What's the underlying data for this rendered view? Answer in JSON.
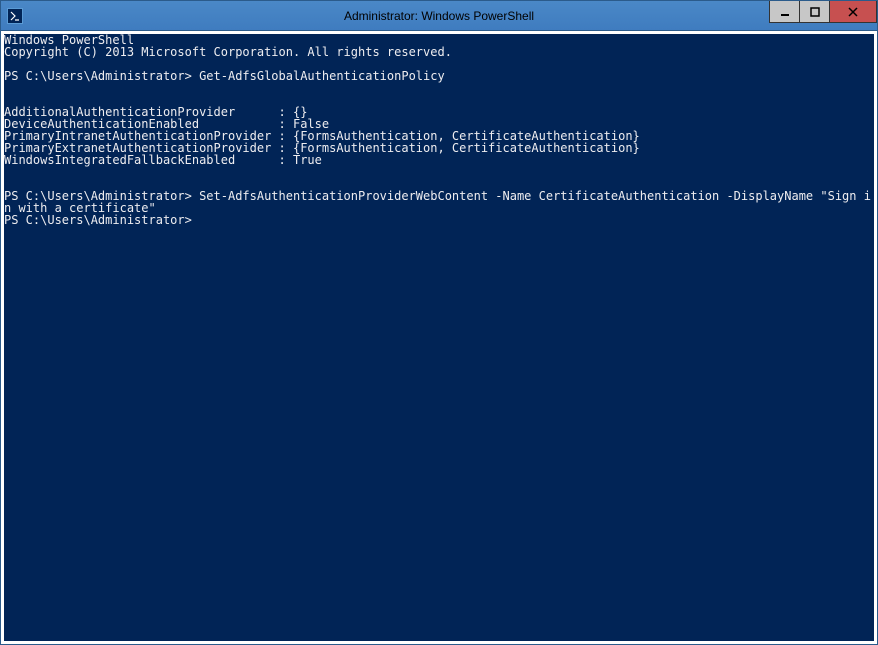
{
  "window": {
    "title": "Administrator: Windows PowerShell"
  },
  "console": {
    "banner": [
      "Windows PowerShell",
      "Copyright (C) 2013 Microsoft Corporation. All rights reserved."
    ],
    "prompt1": "PS C:\\Users\\Administrator>",
    "cmd1": "Get-AdfsGlobalAuthenticationPolicy",
    "output1": [
      "",
      "",
      "AdditionalAuthenticationProvider      : {}",
      "DeviceAuthenticationEnabled           : False",
      "PrimaryIntranetAuthenticationProvider : {FormsAuthentication, CertificateAuthentication}",
      "PrimaryExtranetAuthenticationProvider : {FormsAuthentication, CertificateAuthentication}",
      "WindowsIntegratedFallbackEnabled      : True",
      "",
      ""
    ],
    "prompt2": "PS C:\\Users\\Administrator>",
    "cmd2_wrapped": [
      "Set-AdfsAuthenticationProviderWebContent -Name CertificateAuthentication -DisplayName \"Sign i",
      "n with a certificate\""
    ],
    "prompt3": "PS C:\\Users\\Administrator>"
  }
}
